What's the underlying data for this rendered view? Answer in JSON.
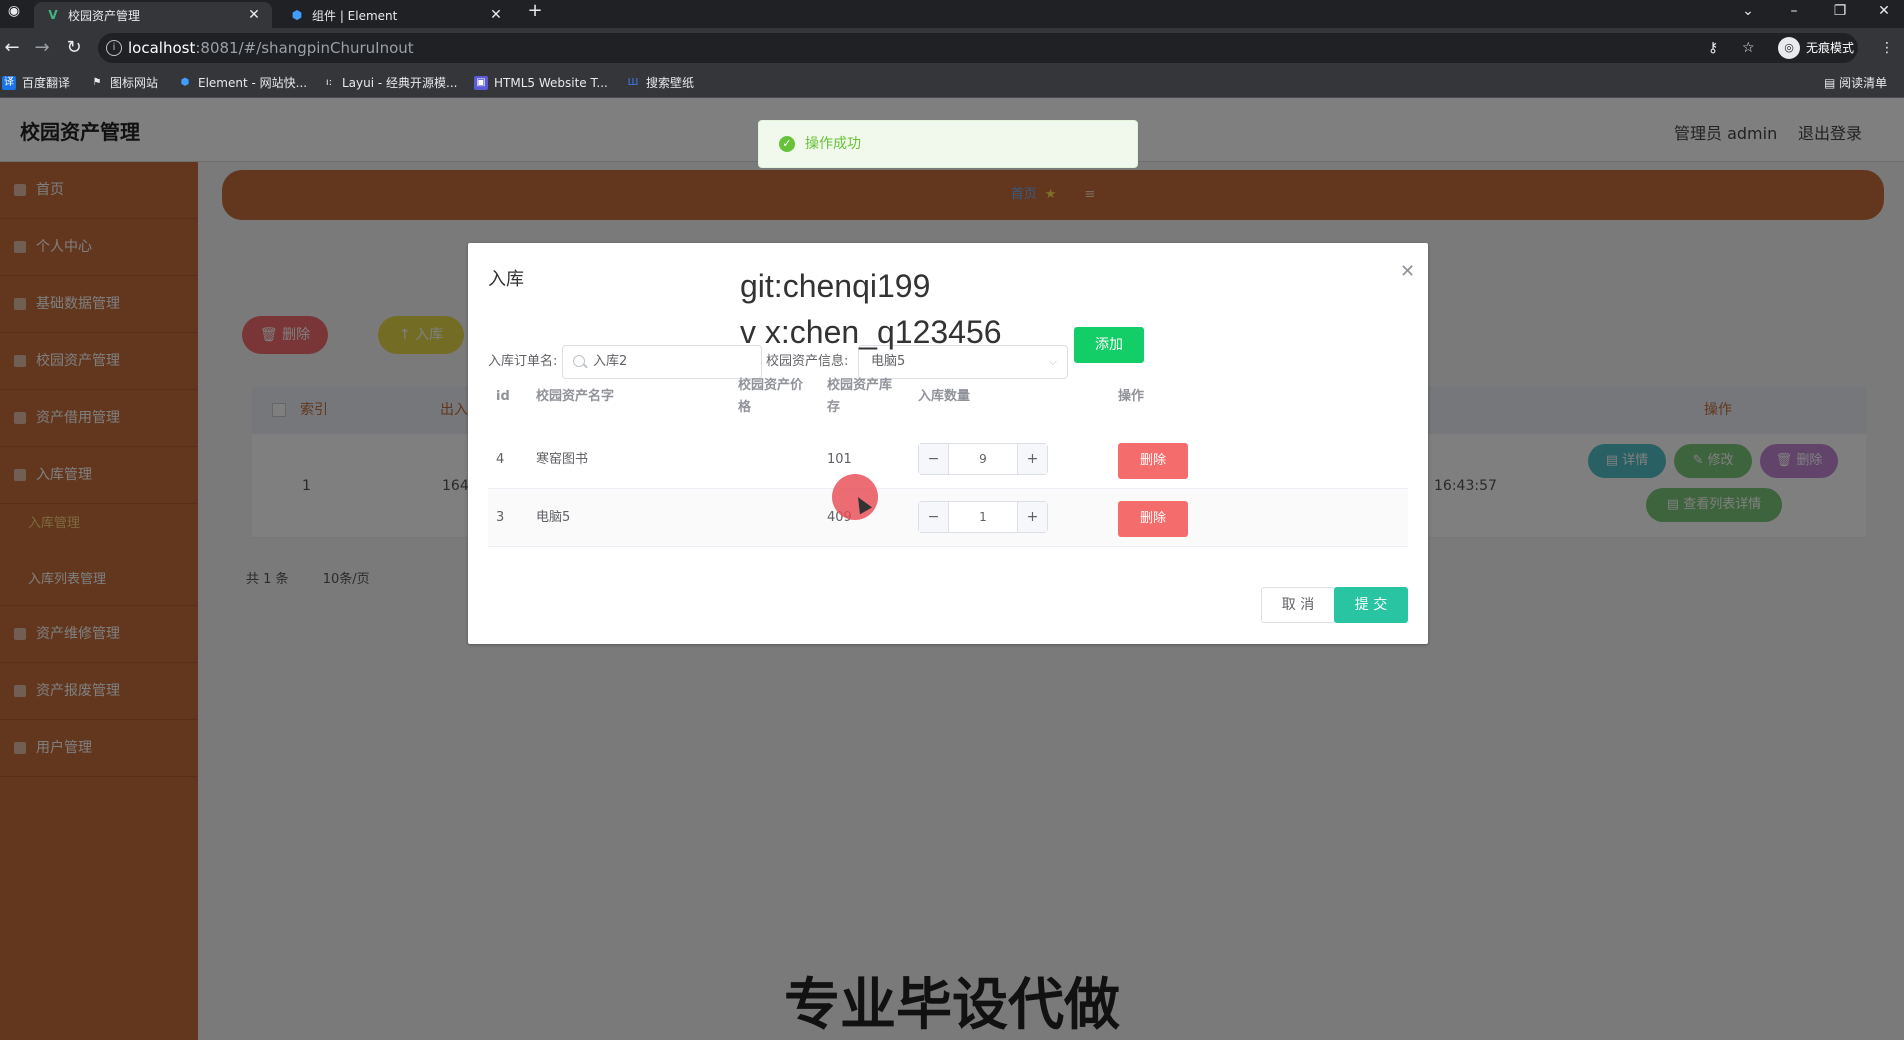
{
  "browser": {
    "tabs": [
      {
        "title": "校园资产管理",
        "icon": "vue-logo-icon",
        "active": true
      },
      {
        "title": "组件 | Element",
        "icon": "element-logo-icon",
        "active": false
      }
    ],
    "url_host": "localhost",
    "url_path": ":8081/#/shangpinChuruInout",
    "incognito_label": "无痕模式",
    "reading_list_label": "阅读清单",
    "bookmarks": [
      {
        "label": "百度翻译",
        "icon": "baidu-translate-icon",
        "color": "#1a73e8"
      },
      {
        "label": "图标网站",
        "icon": "flag-icon",
        "color": "#e8eaed"
      },
      {
        "label": "Element - 网站快...",
        "icon": "element-logo-icon",
        "color": "#409eff"
      },
      {
        "label": "Layui - 经典开源模...",
        "icon": "layui-icon",
        "color": "#e8eaed"
      },
      {
        "label": "HTML5 Website T...",
        "icon": "html5-template-icon",
        "color": "#5b5bd6"
      },
      {
        "label": "搜索壁纸",
        "icon": "wallpaper-icon",
        "color": "#3c7cf0"
      }
    ]
  },
  "app": {
    "title": "校园资产管理",
    "user_label": "管理员 admin",
    "logout_label": "退出登录",
    "menu": [
      {
        "label": "首页"
      },
      {
        "label": "个人中心"
      },
      {
        "label": "基础数据管理"
      },
      {
        "label": "校园资产管理"
      },
      {
        "label": "资产借用管理"
      },
      {
        "label": "入库管理"
      },
      {
        "label": "资产维修管理"
      },
      {
        "label": "资产报废管理"
      },
      {
        "label": "用户管理"
      }
    ],
    "submenu": [
      {
        "label": "入库管理",
        "active": true
      },
      {
        "label": "入库列表管理",
        "active": false
      }
    ],
    "breadcrumb": "首页",
    "toolbar": {
      "delete_label": "删除",
      "stock_in_label": "入库"
    },
    "grid_headers": {
      "index": "索引",
      "col2": "出入",
      "ops": "操作"
    },
    "grid_row": {
      "index": "1",
      "code_fragment": "164",
      "time_fragment": "16:43:57"
    },
    "row_actions": {
      "detail": "详情",
      "edit": "修改",
      "delete": "删除",
      "view_list": "查看列表详情"
    },
    "pager": {
      "total": "共 1 条",
      "page_size": "10条/页"
    }
  },
  "toast": {
    "message": "操作成功",
    "color": "#67c23a"
  },
  "dialog": {
    "title": "入库",
    "order_name_label": "入库订单名:",
    "order_name_value": "入库2",
    "asset_info_label": "校园资产信息:",
    "asset_info_value": "电脑5",
    "add_label": "添加",
    "columns": {
      "id": "id",
      "name": "校园资产名字",
      "price": "校园资产价格",
      "stock": "校园资产库存",
      "qty": "入库数量",
      "ops": "操作"
    },
    "rows": [
      {
        "id": "4",
        "name": "寒窑图书",
        "price": "",
        "stock": "101",
        "qty": "9",
        "delete_label": "删除"
      },
      {
        "id": "3",
        "name": "电脑5",
        "price": "",
        "stock": "409",
        "qty": "1",
        "delete_label": "删除"
      }
    ],
    "cancel_label": "取 消",
    "submit_label": "提 交"
  },
  "overlay_text": {
    "watermark_git": "git:chenqi199",
    "watermark_vx": "v x:chen_q123456",
    "caption": "专业毕设代做"
  },
  "colors": {
    "sidebar": "#c46f3d",
    "add_button": "#13ce66",
    "delete_button": "#f56c6c",
    "submit_button": "#29c5a3"
  }
}
